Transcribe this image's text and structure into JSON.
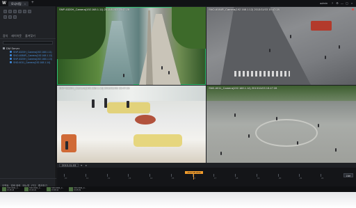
{
  "titlebar": {
    "logo": "W",
    "tab_label": "모니터링",
    "close_glyph": "×",
    "new_tab_glyph": "+",
    "user": "admin",
    "controls": [
      "?",
      "⚙",
      "—",
      "▢",
      "×"
    ]
  },
  "sidebar": {
    "tabs": [
      "장치",
      "레이아웃",
      "즐겨찾기"
    ],
    "tree_root": "DM Server",
    "tree_items": [
      "SNP-6320H_Camera(192.168.1.11)",
      "SNO-6084R_Camera(192.168.1.12)",
      "SNP-6320H_Camera(192.168.1.13)",
      "SND-6011_Camera(192.168.1.14)"
    ],
    "bottom_tabs": [
      "이벤트",
      "알람 출력",
      "메뉴얼",
      "PTZ",
      "즐겨찾기"
    ]
  },
  "tiles": [
    {
      "caption": "SNP-6320H_Camera(192.168.1.11)  2013/11/03 15:47:28"
    },
    {
      "caption": "SNO-6084R_Camera(192.168.1.12)  2013/11/03 15:47:28"
    },
    {
      "caption": "SNP-6320H_Camera(192.168.1.13)  2013/11/03 15:47:28"
    },
    {
      "caption": "SND-6011_Camera(192.168.1.14)  2013/11/03 15:47:28"
    }
  ],
  "timeline": {
    "date": "2013-11-03",
    "current_time": "15:47:28 2013",
    "tick_labels": [
      "10",
      "11",
      "12",
      "13",
      "14",
      "15",
      "16",
      "17",
      "18",
      "19",
      "20",
      "21",
      "22"
    ],
    "live_label": "Live"
  },
  "thumbnails": [
    {
      "name": "SNO-6020_C...",
      "time": "15:45:18"
    },
    {
      "name": "SNO-6020_C...",
      "time": "15:40:22"
    },
    {
      "name": "SNO-6020_C...",
      "time": "15:38:44"
    },
    {
      "name": "SNO-6020_C...",
      "time": "15:35:09"
    }
  ],
  "colors": {
    "selection": "#2fbf71",
    "playhead": "#f29c2b",
    "camera_link": "#4a8fd8"
  }
}
